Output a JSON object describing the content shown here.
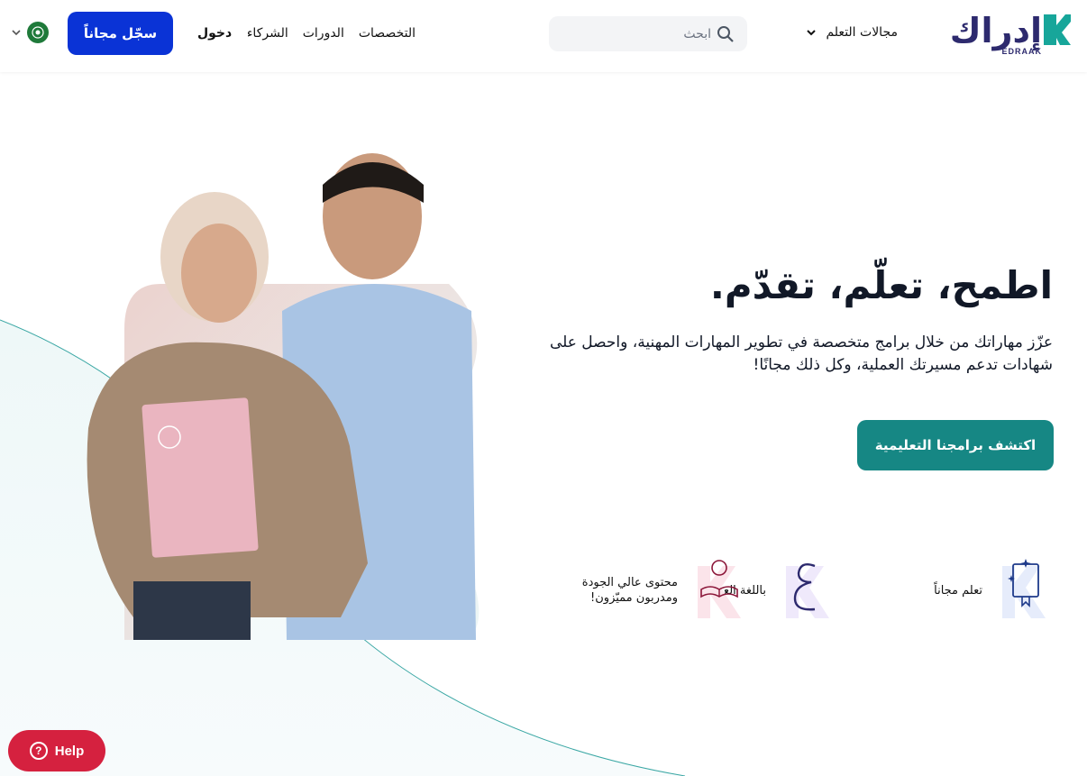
{
  "header": {
    "logo_ar": "إدراك",
    "logo_en": "EDRAAK",
    "fields_label": "مجالات التعلم",
    "search_placeholder": "ابحث",
    "nav": [
      "التخصصات",
      "الدورات",
      "الشركاء"
    ],
    "login_label": "دخول",
    "signup_label": "سجّل مجاناً"
  },
  "hero": {
    "title": "اطمح، تعلّم، تقدّم.",
    "description": "عزّز مهاراتك من خلال برامج متخصصة في تطوير المهارات المهنية، واحصل على شهادات تدعم مسيرتك العملية، وكل ذلك مجانًا!",
    "cta_label": "اكتشف برامجنا التعليمية"
  },
  "features": [
    {
      "label": "تعلم مجاناً",
      "icon": "free-book-icon"
    },
    {
      "label": "باللغة العربية",
      "icon": "arabic-letter-icon"
    },
    {
      "label_line1": "محتوى عالي الجودة",
      "label_line2": "ومدربون مميّزون!",
      "icon": "quality-content-icon"
    }
  ],
  "help": {
    "label": "Help"
  },
  "colors": {
    "brand_navy": "#2d2a6e",
    "brand_teal": "#17a69a",
    "signup_blue": "#0a33d6",
    "cta_teal": "#168784",
    "help_red": "#d5213f"
  }
}
